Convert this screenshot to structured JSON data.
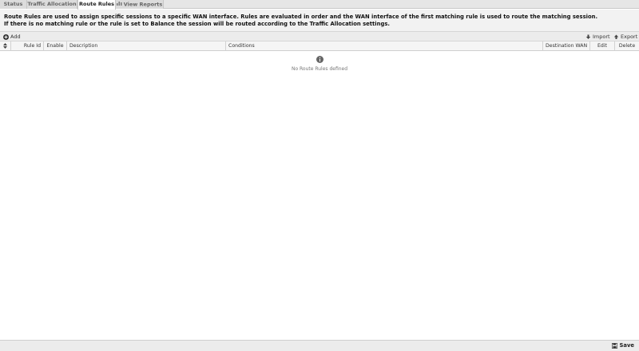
{
  "tabs": [
    {
      "label": "Status"
    },
    {
      "label": "Traffic Allocation"
    },
    {
      "label": "Route Rules",
      "active": true
    },
    {
      "label": "View Reports",
      "icon": "chart-icon"
    }
  ],
  "description": {
    "line1": "Route Rules are used to assign specific sessions to a specific WAN interface. Rules are evaluated in order and the WAN interface of the first matching rule is used to route the matching session.",
    "line2": "If there is no matching rule or the rule is set to Balance the session will be routed according to the Traffic Allocation settings."
  },
  "toolbar": {
    "add_label": "Add",
    "import_label": "Import",
    "export_label": "Export"
  },
  "grid": {
    "columns": {
      "reorder": "",
      "rule_id": "Rule Id",
      "enable": "Enable",
      "description": "Description",
      "conditions": "Conditions",
      "destination_wan": "Destination WAN",
      "edit": "Edit",
      "delete": "Delete"
    },
    "empty_message": "No Route Rules defined"
  },
  "footer": {
    "save_label": "Save"
  }
}
